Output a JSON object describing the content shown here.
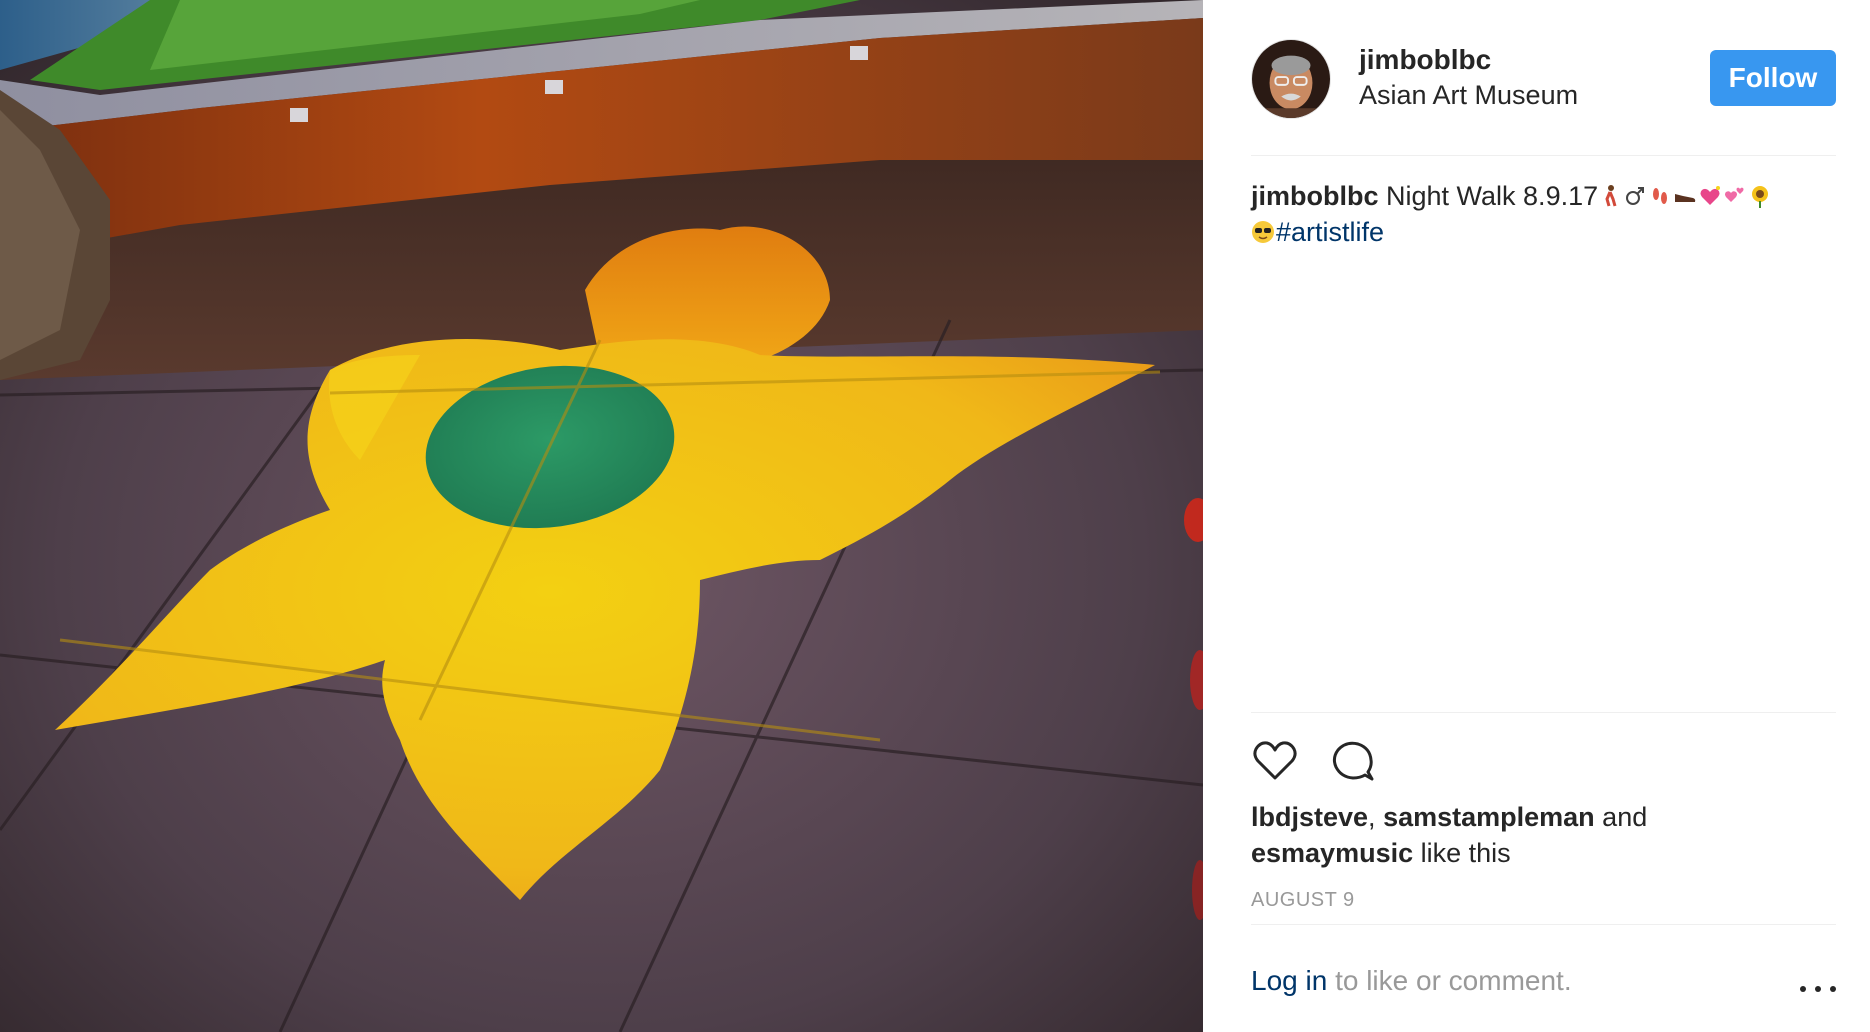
{
  "post": {
    "image_alt": "Painted yellow flower with green center on a sidewalk at night",
    "image_icon": "photo-sidewalk-flower"
  },
  "header": {
    "username": "jimboblbc",
    "location": "Asian Art Museum",
    "follow_label": "Follow",
    "avatar_icon": "avatar-icon"
  },
  "caption": {
    "username": "jimboblbc",
    "text": "Night Walk 8.9.17",
    "emojis": [
      "person-walking-emoji",
      "male-sign-emoji",
      "footprints-emoji",
      "shoe-emoji",
      "sparkling-heart-emoji",
      "two-hearts-emoji",
      "sunflower-emoji",
      "sunglasses-emoji"
    ],
    "hashtag": "#artistlife"
  },
  "actions": {
    "like_icon": "heart-icon",
    "comment_icon": "comment-icon"
  },
  "likes": {
    "user1": "lbdjsteve",
    "separator": ", ",
    "user2": "samstampleman",
    "and_text": " and",
    "user3": "esmaymusic",
    "suffix": " like this"
  },
  "date": "AUGUST 9",
  "footer": {
    "login_link": "Log in",
    "login_text": " to like or comment.",
    "more_icon": "more-options-icon"
  },
  "colors": {
    "follow_button": "#3897f0",
    "link": "#003569",
    "muted": "#999999",
    "text": "#262626",
    "divider": "#efefef"
  }
}
